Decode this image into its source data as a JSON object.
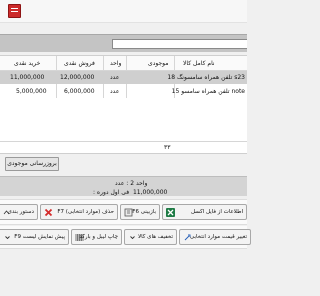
{
  "grid": {
    "columns": [
      "نام کامل کالا",
      "موجودی",
      "واحد",
      "فروش نقدی",
      "خرید نقدی"
    ],
    "rows": [
      {
        "name": "s23 تلفن همراه سامسونگ 18",
        "stock": "",
        "unit": "عدد",
        "sale_price": "12,000,000",
        "buy_price": "11,000,000",
        "selected": true
      },
      {
        "name": "note تلفن همراه سامسو 15",
        "stock": "",
        "unit": "عدد",
        "sale_price": "6,000,000",
        "buy_price": "5,000,000",
        "selected": false
      }
    ],
    "total_stock": "۳۳"
  },
  "refresh_button": "بروزرسانی موجودی",
  "info": {
    "unit_label": "واحد 2 : عدد",
    "cost_label": "فی اول دوره :",
    "cost_value": "11,000,000"
  },
  "toolbar_row1": [
    {
      "label": "اطلاعات از فایل اکسل",
      "icon": "excel-icon"
    },
    {
      "label": "بازبینی F6",
      "icon": "review-icon"
    },
    {
      "label": "حذف (موارد انتخابی) F7",
      "icon": "delete-icon"
    },
    {
      "label": "دستور بندی",
      "icon": "sort-icon"
    }
  ],
  "toolbar_row2": [
    {
      "label": "تغییر قیمت موارد انتخابی",
      "icon": "price-change-icon"
    },
    {
      "label": "تخفیف های کالا",
      "icon": "discount-icon"
    },
    {
      "label": "چاپ لیبل و بارکد",
      "icon": "barcode-icon"
    },
    {
      "label": "پیش نمایش لیست F9",
      "icon": "print-preview-icon"
    }
  ],
  "colors": {
    "selected_row": "#cfcfcf",
    "excel_green": "#1e7b45",
    "delete_red": "#d42a2a",
    "accent_blue": "#2b62b8"
  }
}
